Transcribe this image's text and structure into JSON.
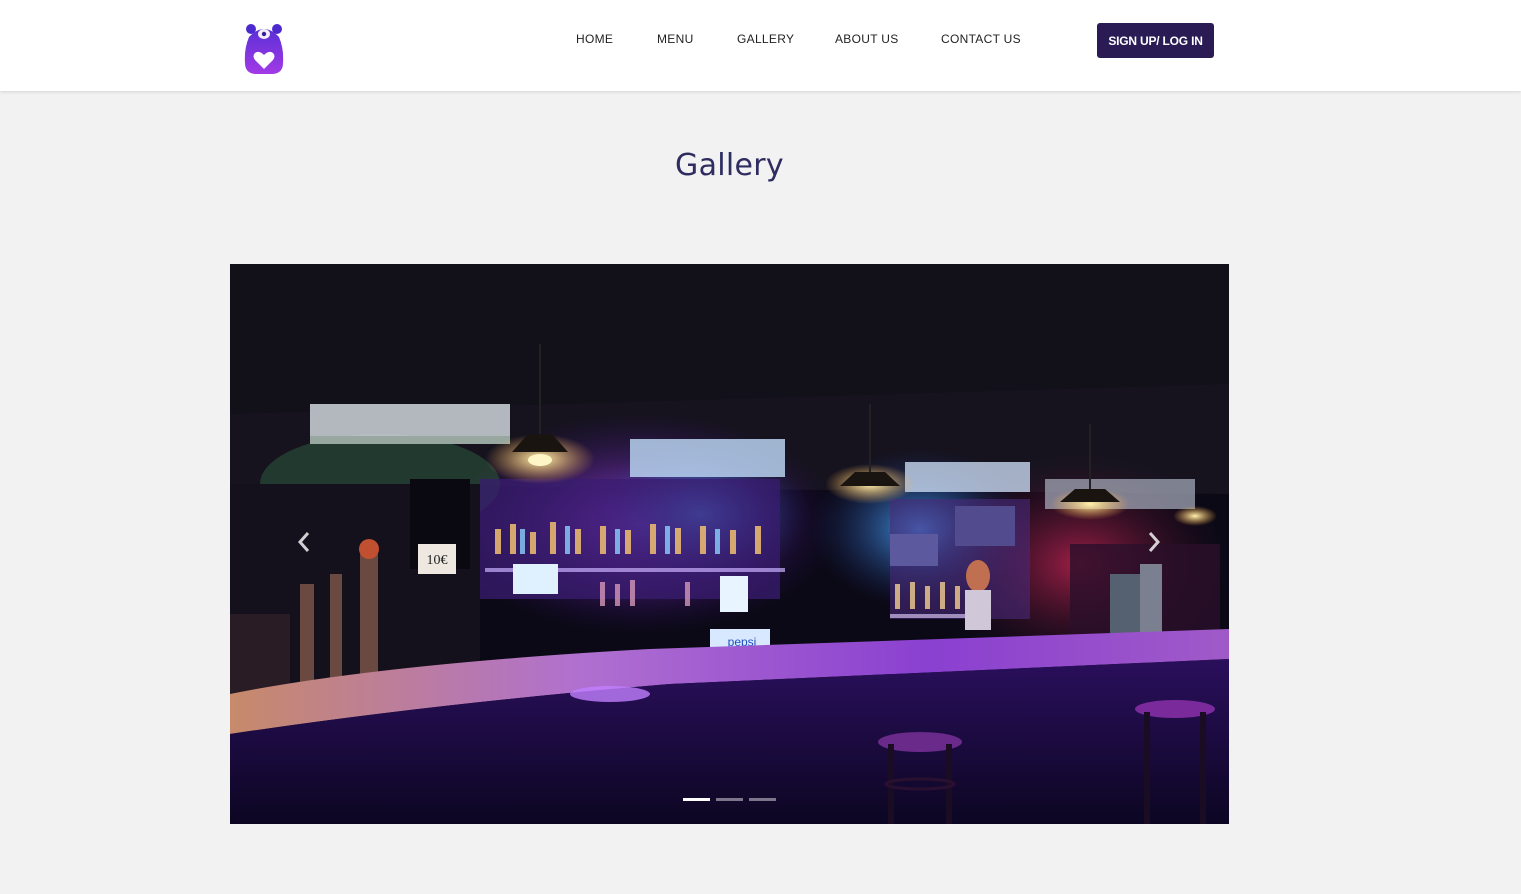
{
  "nav": {
    "items": [
      {
        "label": "HOME"
      },
      {
        "label": "MENU"
      },
      {
        "label": "GALLERY"
      },
      {
        "label": "ABOUT US"
      },
      {
        "label": "CONTACT US"
      }
    ],
    "signup_label": "SIGN UP/ LOG IN"
  },
  "page": {
    "title": "Gallery"
  },
  "carousel": {
    "active_slide": 1,
    "slide_count": 3,
    "image_text": {
      "price_tag": "10€",
      "brand_sign": "pepsi"
    }
  },
  "colors": {
    "brand_dark": "#2a1b55",
    "title": "#2f2c60",
    "logo_purple": "#7a2ce0"
  }
}
